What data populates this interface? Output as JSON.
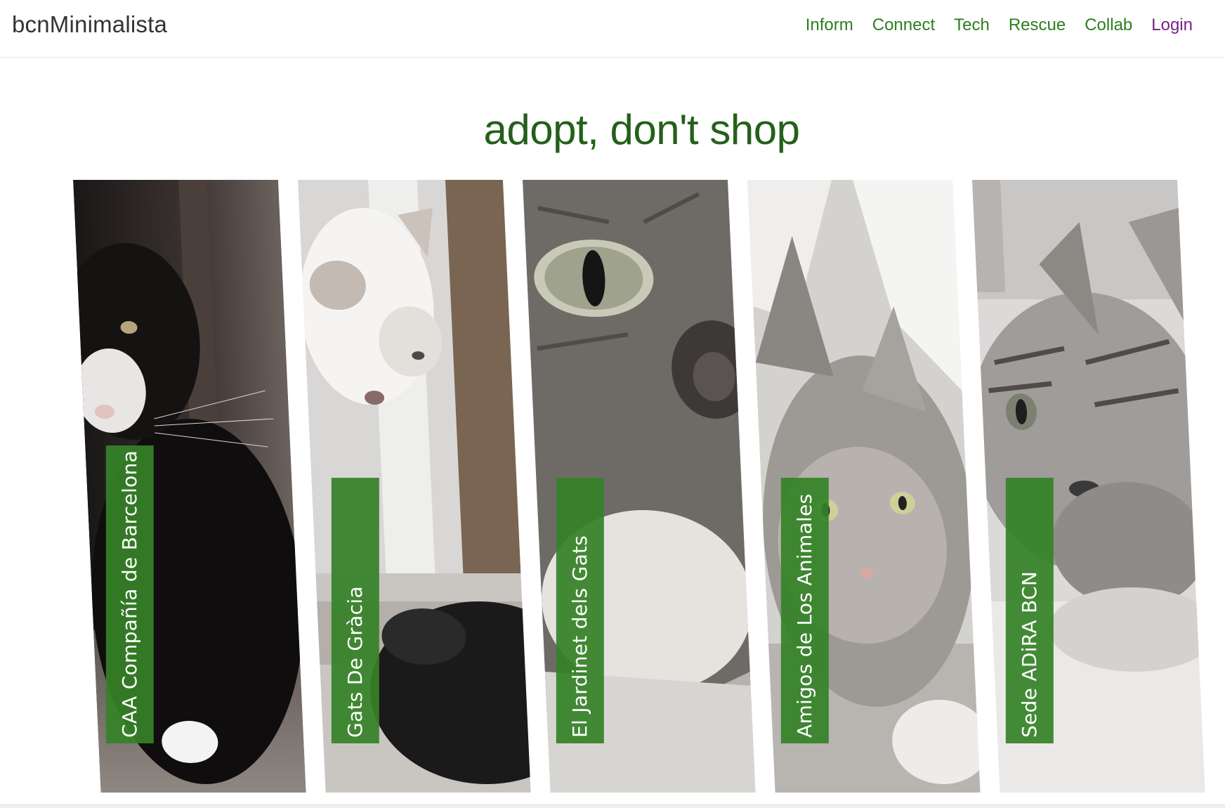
{
  "brand": "bcnMinimalista",
  "nav": {
    "items": [
      "Inform",
      "Connect",
      "Tech",
      "Rescue",
      "Collab"
    ],
    "login": "Login"
  },
  "headline": "adopt, don't shop",
  "colors": {
    "nav_link": "#2e7d1f",
    "login_link": "#7a1f8a",
    "headline": "#24601a",
    "label_bg": "#368228"
  },
  "shelters": [
    {
      "name": "CAA Compañía de Barcelona",
      "image": "black-and-white-cat-photo"
    },
    {
      "name": "Gats De Gràcia",
      "image": "white-kitten-and-dog-nose-photo"
    },
    {
      "name": "El Jardinet dels Gats",
      "image": "tabby-cat-closeup-photo"
    },
    {
      "name": "Amigos de Los Animales",
      "image": "grey-kitten-photo"
    },
    {
      "name": "Sede ADiRA BCN",
      "image": "tabby-cat-lying-photo"
    }
  ]
}
